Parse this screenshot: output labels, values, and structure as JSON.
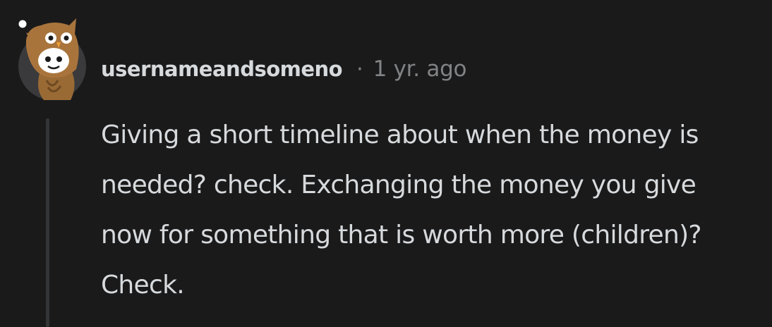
{
  "comment": {
    "avatar_icon": "snoo-owl-costume-avatar-icon",
    "username": "usernameandsomeno",
    "separator": "·",
    "timestamp": "1 yr. ago",
    "body": "Giving a short timeline about when the money is needed? check. Exchanging the money you give now for something that is worth more (children)? Check."
  },
  "colors": {
    "background": "#1a1a1b",
    "text": "#d7dadc",
    "meta": "#818384",
    "thread_line": "#343536"
  }
}
